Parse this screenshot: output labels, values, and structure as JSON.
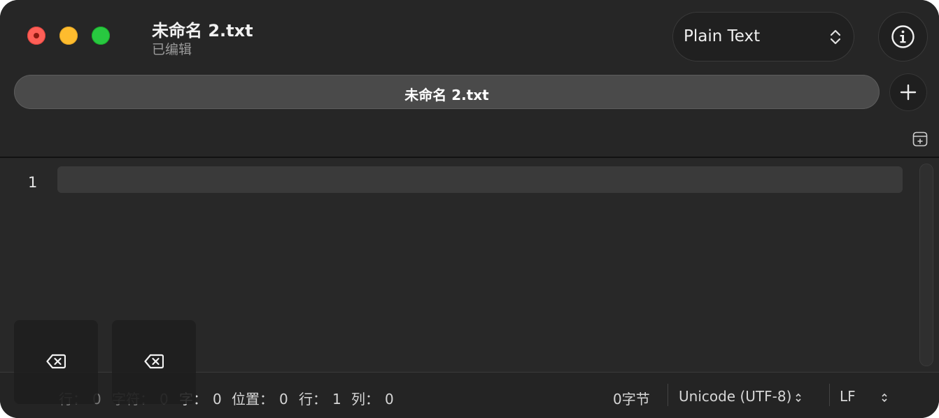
{
  "window": {
    "title": "未命名 2.txt",
    "subtitle": "已编辑"
  },
  "toolbar": {
    "syntax_mode": "Plain Text",
    "info_icon": "info-icon"
  },
  "tabs": [
    {
      "label": "未命名 2.txt",
      "selected": true
    }
  ],
  "editor": {
    "line_numbers": [
      "1"
    ],
    "content": ""
  },
  "statusbar": {
    "lines_label": "行：",
    "lines_value": "0",
    "chars_label": "字符：",
    "chars_value": "0",
    "words_label": "字：",
    "words_value": "0",
    "position_label": "位置：",
    "position_value": "0",
    "row_label": "行：",
    "row_value": "1",
    "col_label": "列：",
    "col_value": "0",
    "file_size": "0字节",
    "encoding": "Unicode (UTF-8)",
    "line_ending": "LF"
  },
  "overlay_keys": [
    {
      "icon": "delete-backward-icon"
    },
    {
      "icon": "delete-backward-icon"
    }
  ],
  "colors": {
    "window_bg": "#2a2a2a",
    "close": "#fe5f57",
    "minimize": "#febc2e",
    "maximize": "#28c840"
  }
}
